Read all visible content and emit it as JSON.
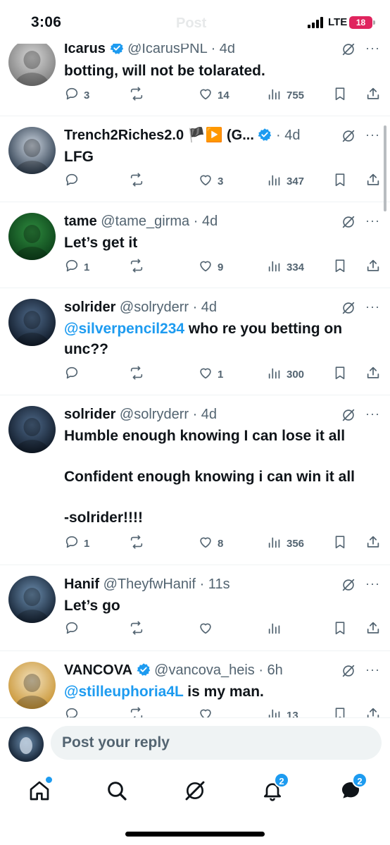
{
  "status_bar": {
    "time": "3:06",
    "title_ghost": "Post",
    "network": "LTE",
    "battery": "18"
  },
  "replies": [
    {
      "name": "Icarus",
      "verified": true,
      "flags": "",
      "handle": "@IcarusPNL",
      "time": "· 4d",
      "paragraphs": [
        [
          "botting, will not be tolarated."
        ]
      ],
      "replies": "3",
      "reposts": "",
      "likes": "14",
      "views": "755",
      "avatar_colors": [
        "#d8d8d8",
        "#7a7a7a"
      ]
    },
    {
      "name": "Trench2Riches2.0",
      "verified": true,
      "flags": "🏴▶️ (G...",
      "handle": "",
      "time": "· 4d",
      "paragraphs": [
        [
          "LFG"
        ]
      ],
      "replies": "",
      "reposts": "",
      "likes": "3",
      "views": "347",
      "avatar_colors": [
        "#cfd8e3",
        "#243446"
      ]
    },
    {
      "name": "tame",
      "verified": false,
      "flags": "",
      "handle": "@tame_girma",
      "time": "· 4d",
      "paragraphs": [
        [
          "Let’s get it"
        ]
      ],
      "replies": "1",
      "reposts": "",
      "likes": "9",
      "views": "334",
      "avatar_colors": [
        "#2e8b3e",
        "#0b3d18"
      ]
    },
    {
      "name": "solrider",
      "verified": false,
      "flags": "",
      "handle": "@solryderr",
      "time": "· 4d",
      "mention": "@silverpencil234",
      "paragraphs": [
        [
          "@silverpencil234",
          " who re you betting on unc??"
        ]
      ],
      "replies": "",
      "reposts": "",
      "likes": "1",
      "views": "300",
      "avatar_colors": [
        "#4f6a8a",
        "#0c1522"
      ]
    },
    {
      "name": "solrider",
      "verified": false,
      "flags": "",
      "handle": "@solryderr",
      "time": "· 4d",
      "paragraphs": [
        [
          "Humble enough knowing I can lose it all"
        ],
        [
          "Confident enough knowing i can win it all"
        ],
        [
          "-solrider!!!!"
        ]
      ],
      "replies": "1",
      "reposts": "",
      "likes": "8",
      "views": "356",
      "avatar_colors": [
        "#4f6a8a",
        "#0c1522"
      ]
    },
    {
      "name": "Hanif",
      "verified": false,
      "flags": "",
      "handle": "@TheyfwHanif",
      "time": "· 11s",
      "paragraphs": [
        [
          "Let’s go"
        ]
      ],
      "replies": "",
      "reposts": "",
      "likes": "",
      "views": "",
      "avatar_colors": [
        "#6d8fb0",
        "#0e1a2a"
      ]
    },
    {
      "name": "VANCOVA",
      "verified": true,
      "flags": "",
      "handle": "@vancova_heis",
      "time": "· 6h",
      "paragraphs": [
        [
          "@stilleuphoria4L",
          " is my man."
        ]
      ],
      "replies": "",
      "reposts": "",
      "likes": "",
      "views": "13",
      "avatar_colors": [
        "#f3e3c0",
        "#c8922f"
      ]
    }
  ],
  "composer": {
    "placeholder": "Post your reply"
  },
  "tabbar": {
    "notifications_badge": "2",
    "messages_badge": "2"
  },
  "colors": {
    "accent": "#1d9bf0",
    "text": "#0f1419",
    "secondary": "#536471"
  }
}
